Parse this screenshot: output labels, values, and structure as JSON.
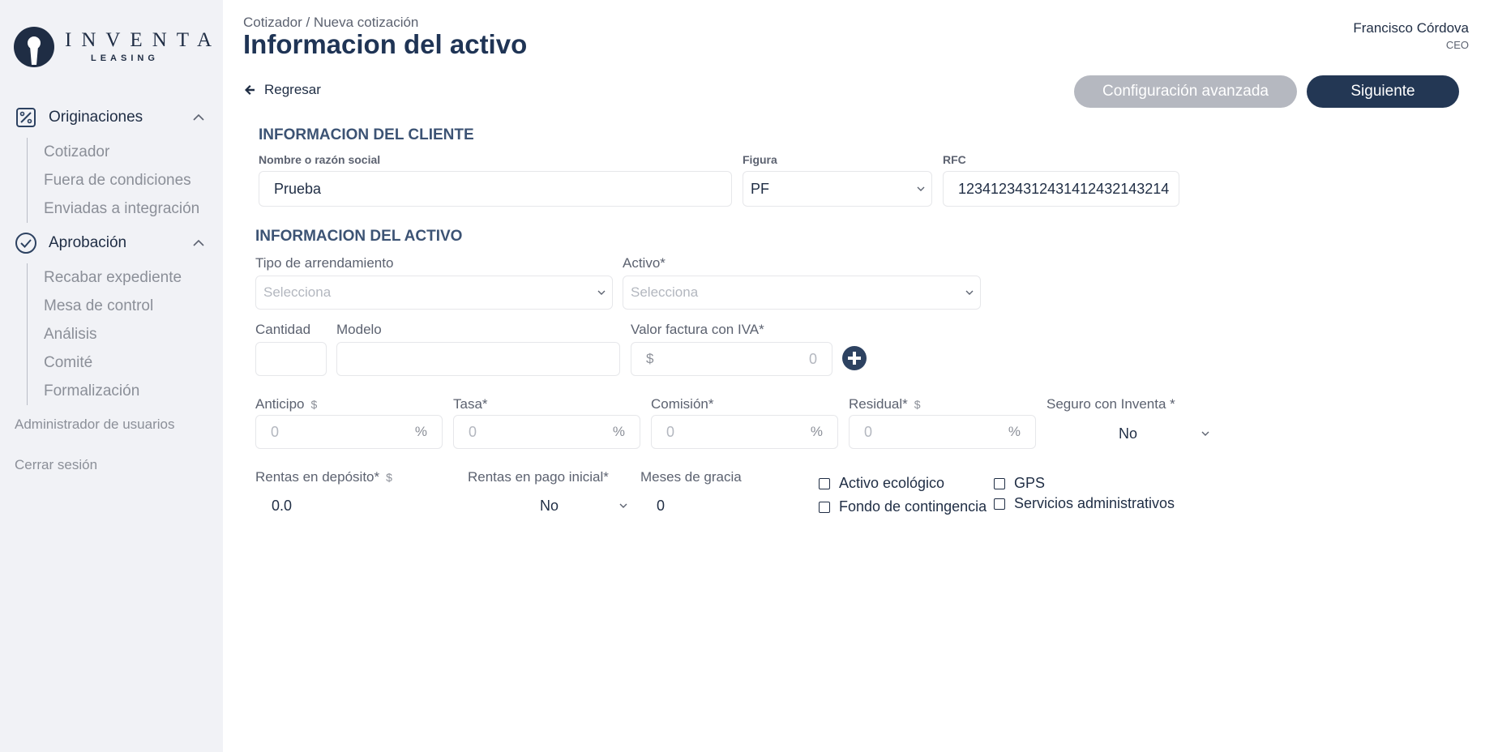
{
  "app": {
    "logo_word": "INVENTA",
    "logo_sub": "LEASING"
  },
  "sidebar": {
    "sections": [
      {
        "label": "Originaciones",
        "icon": "percent-square-icon",
        "items": [
          "Cotizador",
          "Fuera de condiciones",
          "Enviadas a integración"
        ]
      },
      {
        "label": "Aprobación",
        "icon": "check-circle-icon",
        "items": [
          "Recabar expediente",
          "Mesa de control",
          "Análisis",
          "Comité",
          "Formalización"
        ]
      }
    ],
    "admin_label": "Administrador de usuarios",
    "logout_label": "Cerrar sesión"
  },
  "header": {
    "breadcrumb": "Cotizador / Nueva cotización",
    "title": "Informacion del activo",
    "user_name": "Francisco Córdova",
    "user_role": "CEO"
  },
  "toolbar": {
    "back_label": "Regresar",
    "advanced_label": "Configuración avanzada",
    "next_label": "Siguiente"
  },
  "client": {
    "section_title": "INFORMACION DEL CLIENTE",
    "name_label": "Nombre o razón social",
    "name_value": "Prueba",
    "figure_label": "Figura",
    "figure_value": "PF",
    "rfc_label": "RFC",
    "rfc_value": "12341234312431412432143214"
  },
  "asset": {
    "section_title": "INFORMACION DEL ACTIVO",
    "lease_type_label": "Tipo de arrendamiento",
    "lease_type_placeholder": "Selecciona",
    "asset_label": "Activo*",
    "asset_placeholder": "Selecciona",
    "quantity_label": "Cantidad",
    "quantity_value": "",
    "model_label": "Modelo",
    "model_value": "",
    "invoice_label": "Valor factura con IVA*",
    "invoice_currency": "$",
    "invoice_value": "0",
    "down_payment_label": "Anticipo",
    "down_payment_value": "0",
    "rate_label": "Tasa*",
    "rate_value": "0",
    "commission_label": "Comisión*",
    "commission_value": "0",
    "residual_label": "Residual*",
    "residual_value": "0",
    "percent_unit": "%",
    "dollar_sign": "$",
    "insurance_label": "Seguro con Inventa *",
    "insurance_value": "No",
    "deposit_rents_label": "Rentas en depósito*",
    "deposit_rents_value": "0.0",
    "initial_rents_label": "Rentas en pago inicial*",
    "initial_rents_value": "No",
    "grace_months_label": "Meses de gracia",
    "grace_months_value": "0",
    "options": {
      "eco_label": "Activo ecológico",
      "eco_checked": false,
      "fund_label": "Fondo de contingencia",
      "fund_checked": false,
      "gps_label": "GPS",
      "gps_checked": false,
      "admin_services_label": "Servicios administrativos",
      "admin_services_checked": false
    }
  },
  "colors": {
    "primary": "#233754",
    "disabled": "#b5b8c0",
    "sidebar_bg": "#f1f2f6",
    "title": "#1f3455",
    "section": "#3c5374"
  }
}
